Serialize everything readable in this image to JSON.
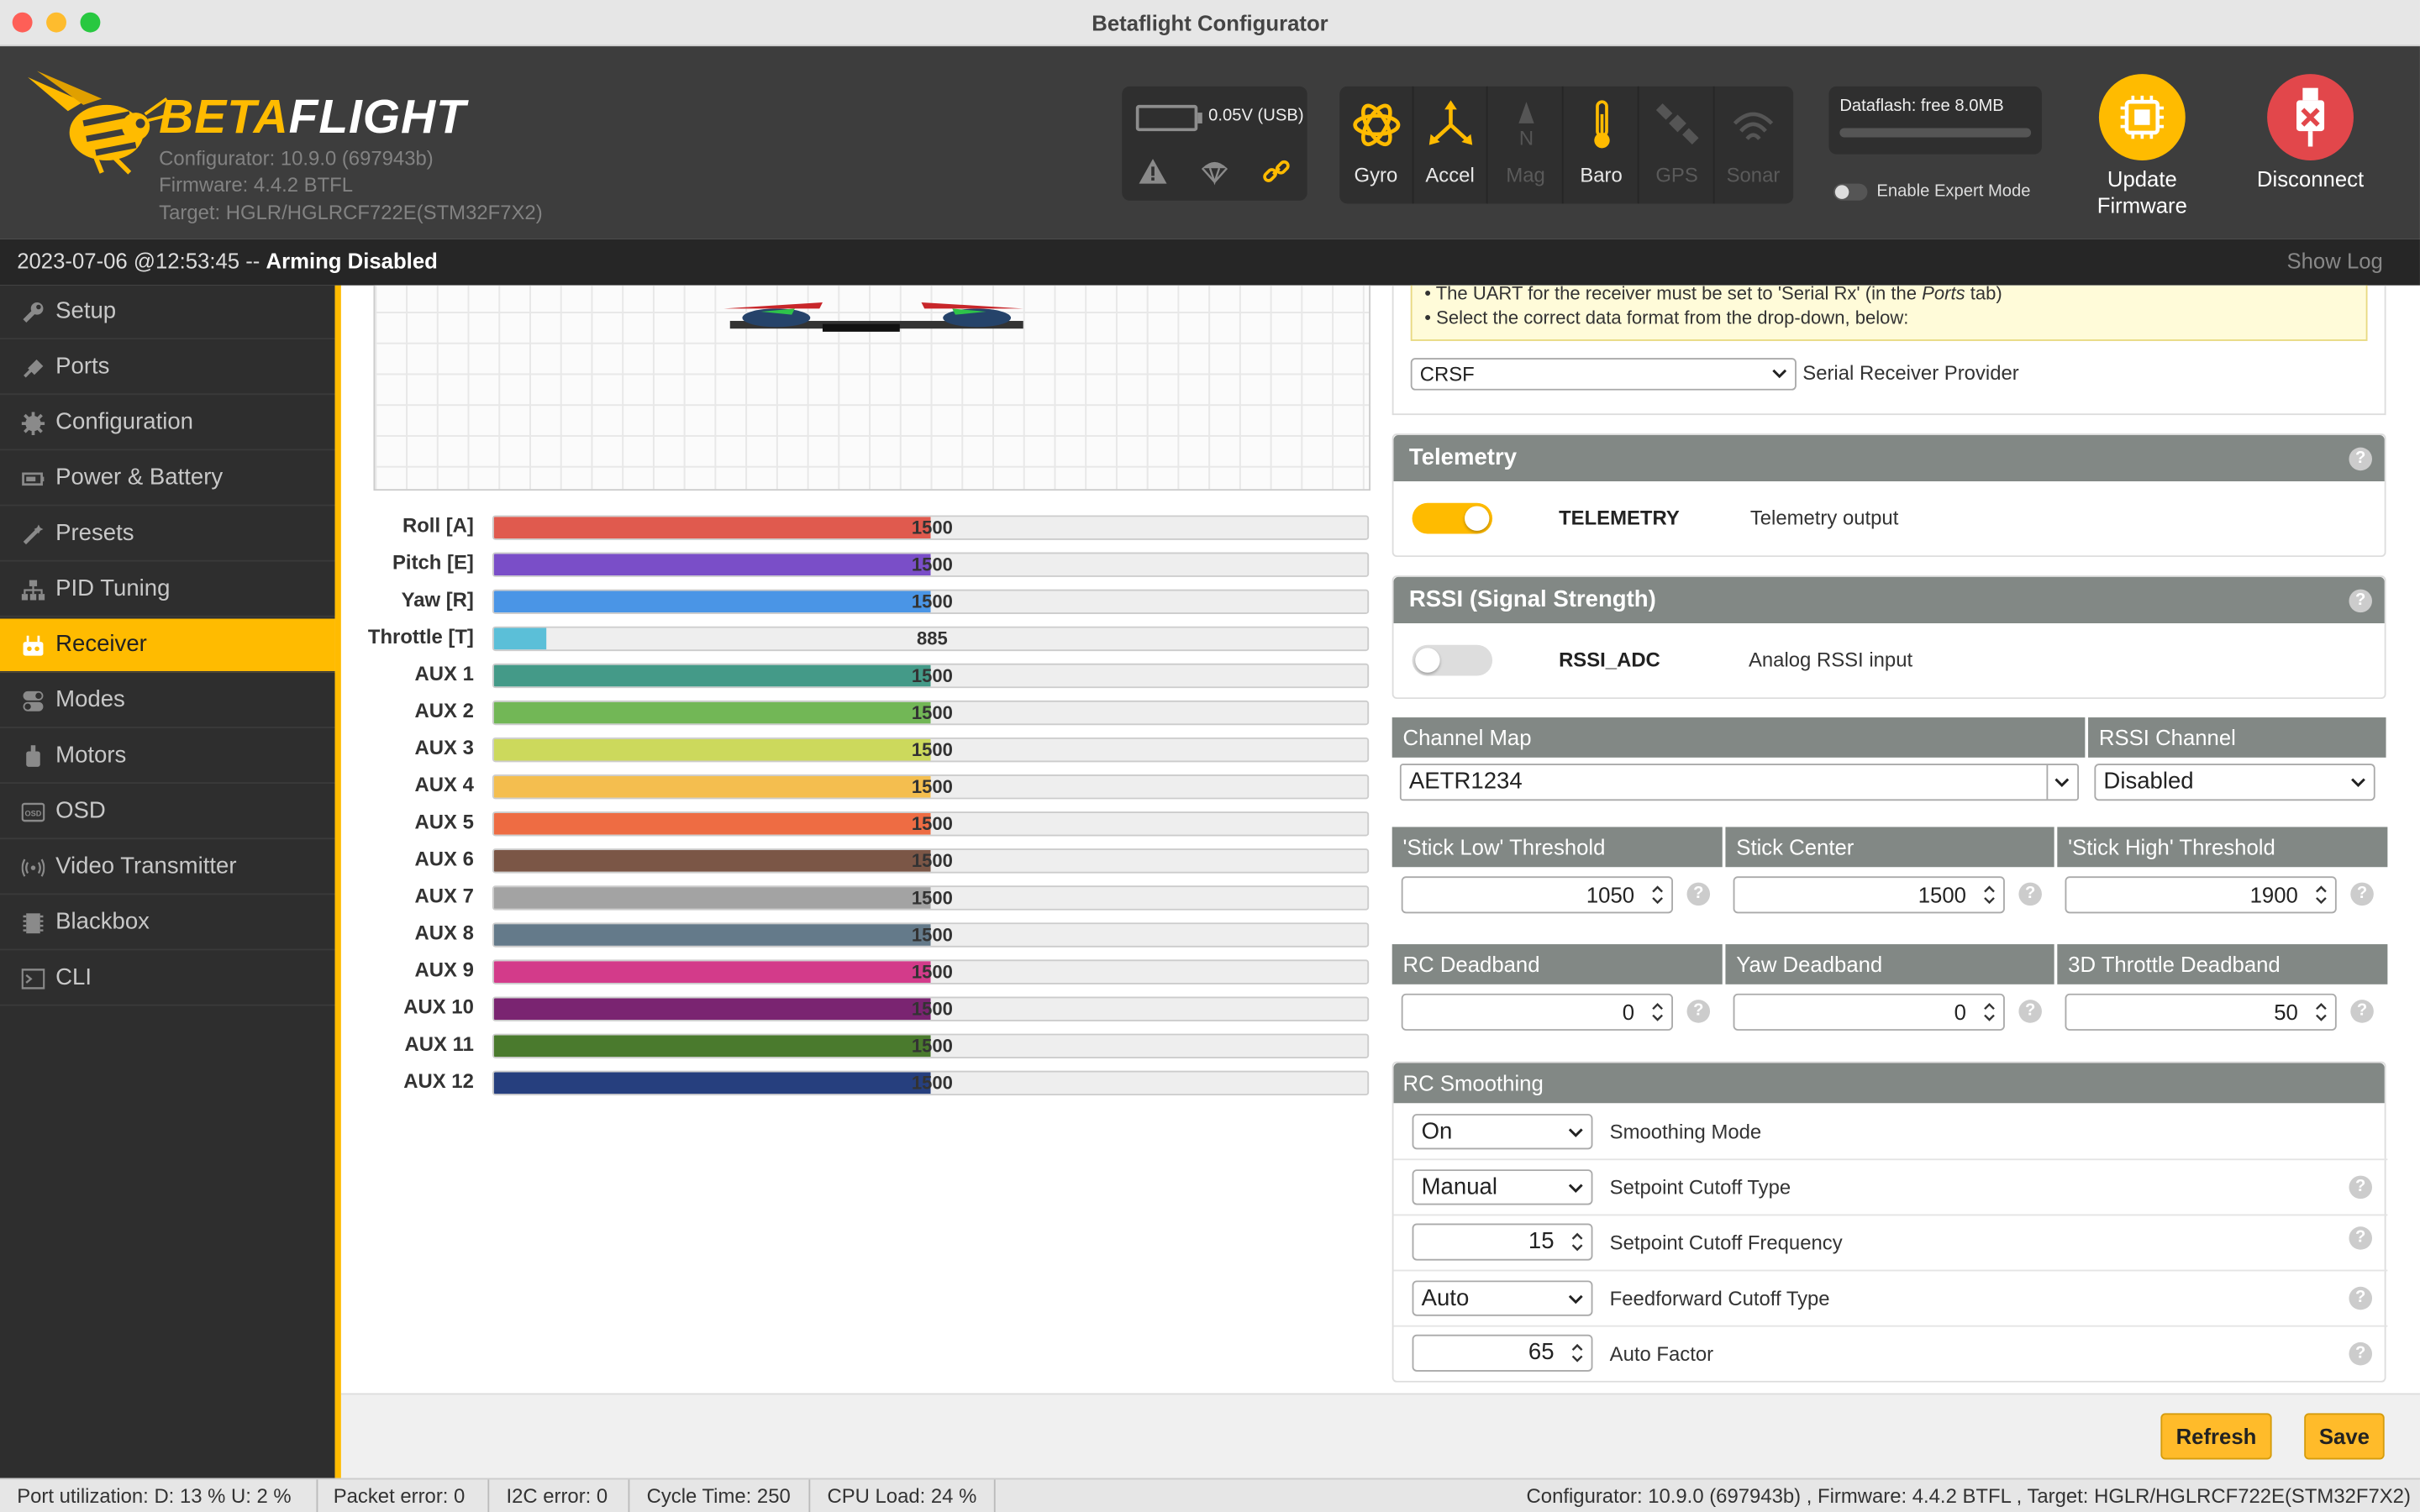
{
  "window": {
    "title": "Betaflight Configurator"
  },
  "header": {
    "brand_part1": "BETA",
    "brand_part2": "FLIGHT",
    "configurator_version": "Configurator: 10.9.0 (697943b)",
    "firmware": "Firmware: 4.4.2 BTFL",
    "target": "Target: HGLR/HGLRCF722E(STM32F7X2)",
    "battery_voltage": "0.05V (USB)",
    "sensors": [
      {
        "label": "Gyro",
        "active": true
      },
      {
        "label": "Accel",
        "active": true
      },
      {
        "label": "Mag",
        "active": false
      },
      {
        "label": "Baro",
        "active": true
      },
      {
        "label": "GPS",
        "active": false
      },
      {
        "label": "Sonar",
        "active": false
      }
    ],
    "dataflash": "Dataflash: free 8.0MB",
    "expert_mode": "Enable Expert Mode",
    "update_firmware_line1": "Update",
    "update_firmware_line2": "Firmware",
    "disconnect": "Disconnect"
  },
  "status": {
    "timestamp": "2023-07-06 @12:53:45 --",
    "state": "Arming Disabled",
    "show_log": "Show Log"
  },
  "sidebar": {
    "items": [
      {
        "label": "Setup",
        "icon": "wrench-icon"
      },
      {
        "label": "Ports",
        "icon": "plug-icon"
      },
      {
        "label": "Configuration",
        "icon": "gear-icon"
      },
      {
        "label": "Power & Battery",
        "icon": "battery-icon"
      },
      {
        "label": "Presets",
        "icon": "magic-wand-icon"
      },
      {
        "label": "PID Tuning",
        "icon": "sitemap-icon"
      },
      {
        "label": "Receiver",
        "icon": "receiver-icon",
        "active": true
      },
      {
        "label": "Modes",
        "icon": "toggle-icon"
      },
      {
        "label": "Motors",
        "icon": "motor-icon"
      },
      {
        "label": "OSD",
        "icon": "osd-icon"
      },
      {
        "label": "Video Transmitter",
        "icon": "antenna-icon"
      },
      {
        "label": "Blackbox",
        "icon": "blackbox-icon"
      },
      {
        "label": "CLI",
        "icon": "terminal-icon"
      }
    ]
  },
  "channels": [
    {
      "name": "Roll [A]",
      "value": "1500",
      "level": 0.5,
      "color": "#e05a4e"
    },
    {
      "name": "Pitch [E]",
      "value": "1500",
      "level": 0.5,
      "color": "#7a4ec8"
    },
    {
      "name": "Yaw [R]",
      "value": "1500",
      "level": 0.5,
      "color": "#4a95e6"
    },
    {
      "name": "Throttle [T]",
      "value": "885",
      "level": 0.06,
      "color": "#5bbfd8"
    },
    {
      "name": "AUX 1",
      "value": "1500",
      "level": 0.5,
      "color": "#449a88"
    },
    {
      "name": "AUX 2",
      "value": "1500",
      "level": 0.5,
      "color": "#72b756"
    },
    {
      "name": "AUX 3",
      "value": "1500",
      "level": 0.5,
      "color": "#ccd95c"
    },
    {
      "name": "AUX 4",
      "value": "1500",
      "level": 0.5,
      "color": "#f4be4f"
    },
    {
      "name": "AUX 5",
      "value": "1500",
      "level": 0.5,
      "color": "#ee6c43"
    },
    {
      "name": "AUX 6",
      "value": "1500",
      "level": 0.5,
      "color": "#7b5646"
    },
    {
      "name": "AUX 7",
      "value": "1500",
      "level": 0.5,
      "color": "#a3a3a3"
    },
    {
      "name": "AUX 8",
      "value": "1500",
      "level": 0.5,
      "color": "#647a8a"
    },
    {
      "name": "AUX 9",
      "value": "1500",
      "level": 0.5,
      "color": "#d33b8a"
    },
    {
      "name": "AUX 10",
      "value": "1500",
      "level": 0.5,
      "color": "#7a2471"
    },
    {
      "name": "AUX 11",
      "value": "1500",
      "level": 0.5,
      "color": "#4a7a2d"
    },
    {
      "name": "AUX 12",
      "value": "1500",
      "level": 0.5,
      "color": "#263f7e"
    }
  ],
  "receiver": {
    "note_line1_pre": "• The UART for the receiver must be set to 'Serial Rx' (in the ",
    "note_line1_em": "Ports",
    "note_line1_post": " tab)",
    "note_line2": "• Select the correct data format from the drop-down, below:",
    "provider_value": "CRSF",
    "provider_label": "Serial Receiver Provider"
  },
  "telemetry": {
    "title": "Telemetry",
    "feature": "TELEMETRY",
    "description": "Telemetry output",
    "enabled": true
  },
  "rssi": {
    "title": "RSSI (Signal Strength)",
    "feature": "RSSI_ADC",
    "description": "Analog RSSI input",
    "enabled": false
  },
  "channel_map": {
    "label": "Channel Map",
    "value": "AETR1234",
    "rssi_channel_label": "RSSI Channel",
    "rssi_channel_value": "Disabled"
  },
  "thresholds": {
    "low_label": "'Stick Low' Threshold",
    "low_value": "1050",
    "center_label": "Stick Center",
    "center_value": "1500",
    "high_label": "'Stick High' Threshold",
    "high_value": "1900"
  },
  "deadbands": {
    "rc_label": "RC Deadband",
    "rc_value": "0",
    "yaw_label": "Yaw Deadband",
    "yaw_value": "0",
    "throttle3d_label": "3D Throttle Deadband",
    "throttle3d_value": "50"
  },
  "smoothing": {
    "title": "RC Smoothing",
    "rows": [
      {
        "value": "On",
        "label": "Smoothing Mode",
        "kind": "select",
        "help": false
      },
      {
        "value": "Manual",
        "label": "Setpoint Cutoff Type",
        "kind": "select",
        "help": true
      },
      {
        "value": "15",
        "label": "Setpoint Cutoff Frequency",
        "kind": "number",
        "help": true
      },
      {
        "value": "Auto",
        "label": "Feedforward Cutoff Type",
        "kind": "select",
        "help": true
      },
      {
        "value": "65",
        "label": "Auto Factor",
        "kind": "number",
        "help": true
      }
    ]
  },
  "buttons": {
    "refresh": "Refresh",
    "save": "Save"
  },
  "bottom": {
    "port_util": "Port utilization: D: 13 % U: 2 %",
    "packet_error": "Packet error: 0",
    "i2c_error": "I2C error: 0",
    "cycle_time": "Cycle Time: 250",
    "cpu_load": "CPU Load: 24 %",
    "version_info": "Configurator: 10.9.0 (697943b) , Firmware: 4.4.2 BTFL , Target: HGLR/HGLRCF722E(STM32F7X2)"
  },
  "colors": {
    "accent": "#ffbb00",
    "header_bg": "#3d3d3d",
    "sidebar_bg": "#2e2e2e",
    "panel_header": "#828885",
    "disconnect": "#e2474b"
  }
}
